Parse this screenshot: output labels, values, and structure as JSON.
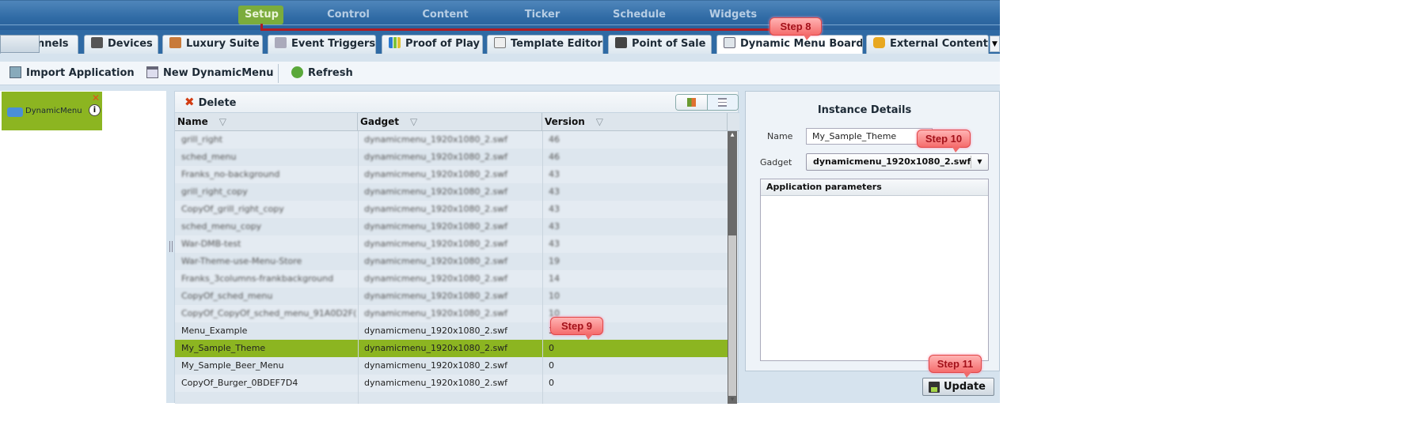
{
  "top_nav": {
    "items": [
      "Setup",
      "Control",
      "Content",
      "Ticker",
      "Schedule",
      "Widgets"
    ],
    "active": "Setup"
  },
  "tabs": [
    {
      "label": "nnels",
      "icon": "channels-icon"
    },
    {
      "label": "Devices",
      "icon": "devices-icon"
    },
    {
      "label": "Luxury Suite",
      "icon": "sofa-icon"
    },
    {
      "label": "Event Triggers",
      "icon": "trigger-icon"
    },
    {
      "label": "Proof of Play",
      "icon": "bar-chart-icon"
    },
    {
      "label": "Template Editor",
      "icon": "template-icon"
    },
    {
      "label": "Point of Sale",
      "icon": "calculator-icon"
    },
    {
      "label": "Dynamic Menu Boards",
      "icon": "window-gear-icon"
    },
    {
      "label": "External Content",
      "icon": "database-icon"
    }
  ],
  "toolbar": {
    "import": "Import Application",
    "new": "New DynamicMenu",
    "refresh": "Refresh"
  },
  "left": {
    "app_label": "DynamicMenu"
  },
  "grid": {
    "delete_label": "Delete",
    "columns": [
      "Name",
      "Gadget",
      "Version"
    ],
    "rows": [
      {
        "name": "grill_right",
        "gadget": "dynamicmenu_1920x1080_2.swf",
        "version": "46",
        "blurred": true
      },
      {
        "name": "sched_menu",
        "gadget": "dynamicmenu_1920x1080_2.swf",
        "version": "46",
        "blurred": true
      },
      {
        "name": "Franks_no-background",
        "gadget": "dynamicmenu_1920x1080_2.swf",
        "version": "43",
        "blurred": true
      },
      {
        "name": "grill_right_copy",
        "gadget": "dynamicmenu_1920x1080_2.swf",
        "version": "43",
        "blurred": true
      },
      {
        "name": "CopyOf_grill_right_copy",
        "gadget": "dynamicmenu_1920x1080_2.swf",
        "version": "43",
        "blurred": true
      },
      {
        "name": "sched_menu_copy",
        "gadget": "dynamicmenu_1920x1080_2.swf",
        "version": "43",
        "blurred": true
      },
      {
        "name": "War-DMB-test",
        "gadget": "dynamicmenu_1920x1080_2.swf",
        "version": "43",
        "blurred": true
      },
      {
        "name": "War-Theme-use-Menu-Store",
        "gadget": "dynamicmenu_1920x1080_2.swf",
        "version": "19",
        "blurred": true
      },
      {
        "name": "Franks_3columns-frankbackground",
        "gadget": "dynamicmenu_1920x1080_2.swf",
        "version": "14",
        "blurred": true
      },
      {
        "name": "CopyOf_sched_menu",
        "gadget": "dynamicmenu_1920x1080_2.swf",
        "version": "10",
        "blurred": true
      },
      {
        "name": "CopyOf_CopyOf_sched_menu_91A0D2F(",
        "gadget": "dynamicmenu_1920x1080_2.swf",
        "version": "10",
        "blurred": true
      },
      {
        "name": "Menu_Example",
        "gadget": "dynamicmenu_1920x1080_2.swf",
        "version": "3",
        "blurred": false
      },
      {
        "name": "My_Sample_Theme",
        "gadget": "dynamicmenu_1920x1080_2.swf",
        "version": "0",
        "blurred": false,
        "selected": true
      },
      {
        "name": "My_Sample_Beer_Menu",
        "gadget": "dynamicmenu_1920x1080_2.swf",
        "version": "0",
        "blurred": false
      },
      {
        "name": "CopyOf_Burger_0BDEF7D4",
        "gadget": "dynamicmenu_1920x1080_2.swf",
        "version": "0",
        "blurred": false
      },
      {
        "name": "",
        "gadget": "",
        "version": "",
        "blurred": false
      }
    ]
  },
  "details": {
    "title": "Instance Details",
    "name_label": "Name",
    "name_value": "My_Sample_Theme",
    "gadget_label": "Gadget",
    "gadget_value": "dynamicmenu_1920x1080_2.swf",
    "params_header": "Application parameters",
    "update_label": "Update"
  },
  "callouts": {
    "step8": "Step 8",
    "step9": "Step 9",
    "step10": "Step 10",
    "step11": "Step 11"
  },
  "colors": {
    "accent_green": "#8cb521",
    "nav_blue": "#2f6aa4",
    "callout_red": "#f56c6c"
  }
}
